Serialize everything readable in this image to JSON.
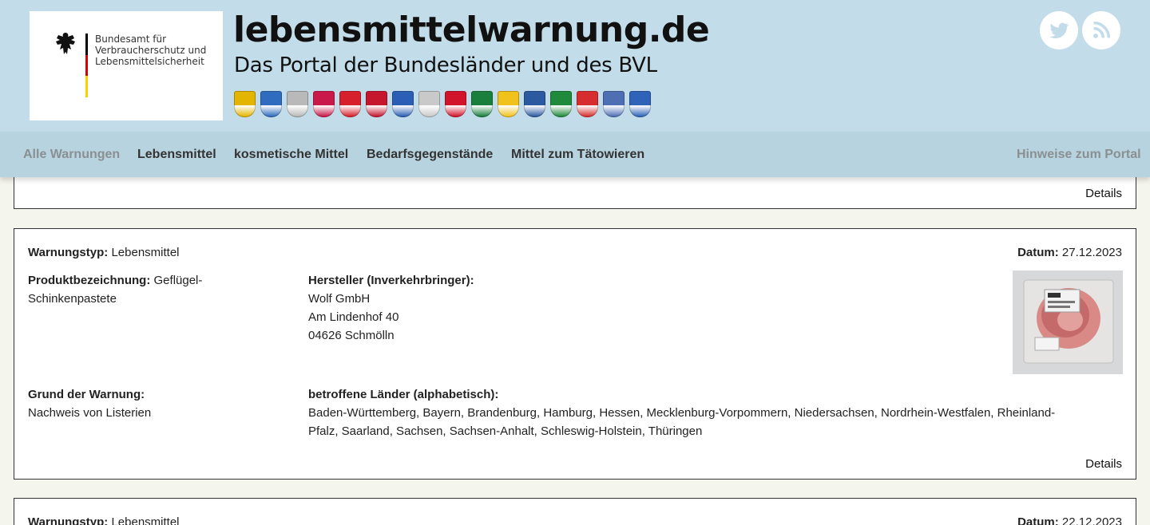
{
  "header": {
    "authority_lines": [
      "Bundesamt für",
      "Verbraucherschutz und",
      "Lebensmittelsicherheit"
    ],
    "site_title": "lebensmittelwarnung.de",
    "site_subtitle": "Das Portal der Bundesländer und des BVL",
    "crest_colors": [
      "#e4b500",
      "#2f6bbf",
      "#b9b9b9",
      "#c9184a",
      "#d6202b",
      "#c5162e",
      "#2b5fb5",
      "#c9c9c9",
      "#d2142b",
      "#1a7f3c",
      "#f1c21b",
      "#2c5aa0",
      "#1f8a3b",
      "#d62e2e",
      "#4f6fb5",
      "#2e63b8"
    ],
    "social": [
      "twitter-icon",
      "rss-icon"
    ]
  },
  "nav": {
    "items": [
      "Alle Warnungen",
      "Lebensmittel",
      "kosmetische Mittel",
      "Bedarfsgegenstände",
      "Mittel zum Tätowieren"
    ],
    "right": "Hinweise zum Portal"
  },
  "cards": {
    "prev": {
      "details": "Details"
    },
    "main": {
      "type_label": "Warnungstyp:",
      "type_value": "Lebensmittel",
      "date_label": "Datum:",
      "date_value": "27.12.2023",
      "product_label": "Produktbezeichnung:",
      "product_value_1": "Geflügel-",
      "product_value_2": "Schinkenpastete",
      "maker_label": "Hersteller (Inverkehrbringer):",
      "maker_lines": [
        "Wolf GmbH",
        "Am Lindenhof 40",
        "04626 Schmölln"
      ],
      "reason_label": "Grund der Warnung:",
      "reason_value": "Nachweis von Listerien",
      "states_label": "betroffene Länder (alphabetisch):",
      "states_line_1": "Baden-Württemberg, Bayern, Brandenburg, Hamburg, Hessen, Mecklenburg-Vorpommern, Niedersachsen, Nordrhein-Westfalen, Rheinland-",
      "states_line_2": "Pfalz, Saarland, Sachsen, Sachsen-Anhalt, Schleswig-Holstein, Thüringen",
      "details": "Details"
    },
    "next": {
      "type_label": "Warnungstyp:",
      "type_value": "Lebensmittel",
      "date_label": "Datum:",
      "date_value": "22.12.2023"
    }
  }
}
